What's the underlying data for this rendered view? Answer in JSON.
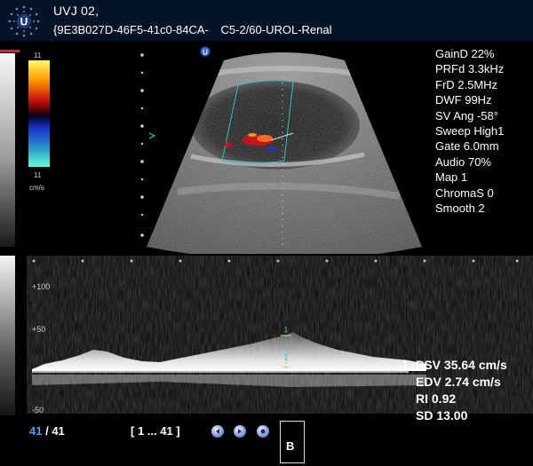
{
  "header": {
    "line1": "UVJ 02,",
    "patient_id": "{9E3B027D-46F5-41c0-84CA-",
    "probe_preset": "C5-2/60-UROL-Renal",
    "logo_letter": "U"
  },
  "color_bar": {
    "top": "11",
    "bottom": "11",
    "unit": "cm/s"
  },
  "image_marker": "U",
  "params": [
    "GainD 22%",
    "PRFd 3.3kHz",
    "FrD 2.5MHz",
    "DWF 99Hz",
    "SV Ang -58°",
    "Sweep High1",
    "Gate 6.0mm",
    "Audio 70%",
    "Map 1",
    "ChromaS 0",
    "Smooth 2"
  ],
  "spectrum_axis": {
    "top": "+100",
    "mid": "+50",
    "bottom": "-50"
  },
  "cursor_marks": {
    "top": "1",
    "mid": "1"
  },
  "measurements": {
    "index": "1",
    "psv": "PSV 35.64 cm/s",
    "edv": "EDV 2.74 cm/s",
    "ri": "RI 0.92",
    "sd": "SD 13.00"
  },
  "footer": {
    "frame_current": "41",
    "frame_total": "/ 41",
    "frame_range": "[ 1 ... 41 ]",
    "b_label": "B"
  },
  "colors": {
    "header_bg": "#031426",
    "accent_blue": "#3aa6ff",
    "roi_cyan": "#22c7c0"
  }
}
